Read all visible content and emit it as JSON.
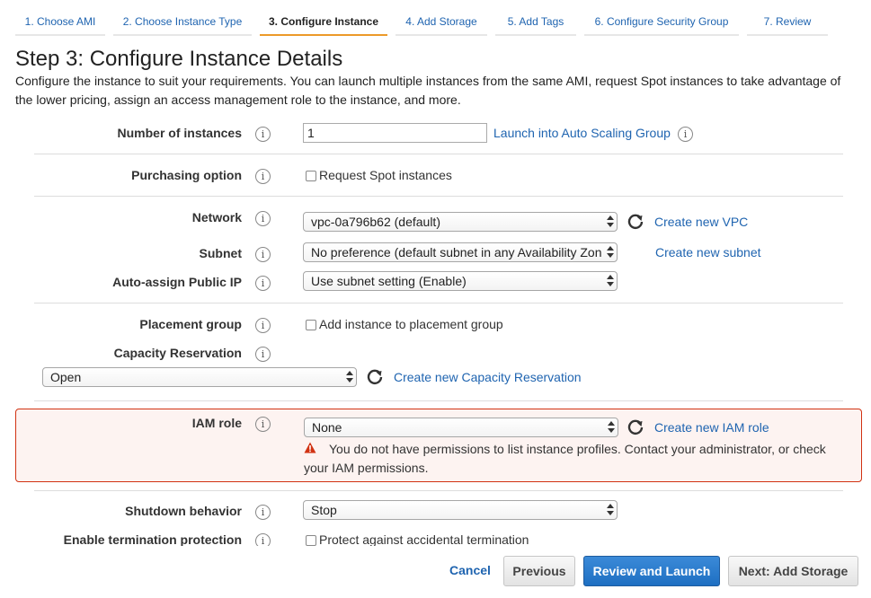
{
  "wizard": {
    "tabs": [
      {
        "label": "1. Choose AMI"
      },
      {
        "label": "2. Choose Instance Type"
      },
      {
        "label": "3. Configure Instance"
      },
      {
        "label": "4. Add Storage"
      },
      {
        "label": "5. Add Tags"
      },
      {
        "label": "6. Configure Security Group"
      },
      {
        "label": "7. Review"
      }
    ],
    "active_tab": "3. Configure Instance"
  },
  "page": {
    "title": "Step 3: Configure Instance Details",
    "description": "Configure the instance to suit your requirements. You can launch multiple instances from the same AMI, request Spot instances to take advantage of the lower pricing, assign an access management role to the instance, and more."
  },
  "form": {
    "number_of_instances": {
      "label": "Number of instances",
      "value": "1",
      "link": "Launch into Auto Scaling Group"
    },
    "purchasing_option": {
      "label": "Purchasing option",
      "checkbox_label": "Request Spot instances",
      "checked": false
    },
    "network": {
      "label": "Network",
      "value": "vpc-0a796b62 (default)",
      "link": "Create new VPC"
    },
    "subnet": {
      "label": "Subnet",
      "value": "No preference (default subnet in any Availability Zon",
      "link": "Create new subnet"
    },
    "auto_assign_ip": {
      "label": "Auto-assign Public IP",
      "value": "Use subnet setting (Enable)"
    },
    "placement_group": {
      "label": "Placement group",
      "checkbox_label": "Add instance to placement group",
      "checked": false
    },
    "capacity_reservation": {
      "label": "Capacity Reservation",
      "value": "Open",
      "link": "Create new Capacity Reservation"
    },
    "iam_role": {
      "label": "IAM role",
      "value": "None",
      "link": "Create new IAM role",
      "error_line1": "You do not have permissions to list instance profiles. Contact your administrator, or check",
      "error_line2": "your IAM permissions."
    },
    "shutdown_behavior": {
      "label": "Shutdown behavior",
      "value": "Stop"
    },
    "termination_protection": {
      "label": "Enable termination protection",
      "checkbox_label": "Protect against accidental termination",
      "checked": false
    }
  },
  "footer": {
    "cancel": "Cancel",
    "previous": "Previous",
    "review_launch": "Review and Launch",
    "next": "Next: Add Storage"
  },
  "colors": {
    "link": "#1f64b0",
    "active_tab_underline": "#ec9a29",
    "error_border": "#d13212",
    "primary_button": "#1e6fc2"
  },
  "icons": {
    "info": "i",
    "refresh": "refresh-icon",
    "warning": "warning-icon"
  }
}
